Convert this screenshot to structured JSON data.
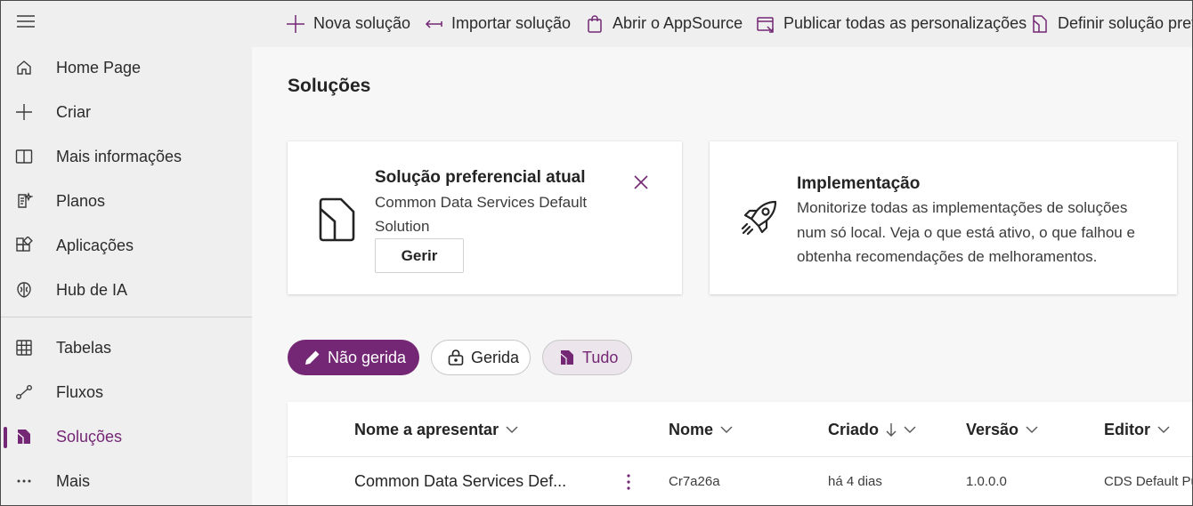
{
  "sidebar": {
    "items": [
      {
        "label": "Home Page",
        "icon": "home-icon"
      },
      {
        "label": "Criar",
        "icon": "plus-icon"
      },
      {
        "label": "Mais informações",
        "icon": "book-icon"
      },
      {
        "label": "Planos",
        "icon": "plan-icon"
      },
      {
        "label": "Aplicações",
        "icon": "apps-icon"
      },
      {
        "label": "Hub de IA",
        "icon": "ai-hub-icon"
      },
      {
        "label": "Tabelas",
        "icon": "table-icon"
      },
      {
        "label": "Fluxos",
        "icon": "flow-icon"
      },
      {
        "label": "Soluções",
        "icon": "solutions-icon",
        "active": true
      },
      {
        "label": "Mais",
        "icon": "more-icon"
      }
    ]
  },
  "toolbar": {
    "new_solution": "Nova solução",
    "import_solution": "Importar solução",
    "open_appsource": "Abrir o AppSource",
    "publish_all": "Publicar todas as personalizações",
    "set_preferred": "Definir solução preferencial"
  },
  "page": {
    "title": "Soluções"
  },
  "preferred_card": {
    "title": "Solução preferencial atual",
    "line1": "Common Data Services Default",
    "line2": "Solution",
    "manage_label": "Gerir"
  },
  "deployment_card": {
    "title": "Implementação",
    "line1": "Monitorize todas as implementações de soluções",
    "line2": "num só local. Veja o que está ativo, o que falhou e",
    "line3": "obtenha recomendações de melhoramentos."
  },
  "filters": {
    "unmanaged": "Não gerida",
    "managed": "Gerida",
    "all": "Tudo"
  },
  "grid": {
    "columns": {
      "display_name": "Nome a apresentar",
      "name": "Nome",
      "created": "Criado",
      "version": "Versão",
      "publisher": "Editor"
    },
    "rows": [
      {
        "display_name": "Common Data Services Def...",
        "name": "Cr7a26a",
        "created": "há 4 dias",
        "version": "1.0.0.0",
        "publisher": "CDS Default Publisher"
      }
    ]
  },
  "colors": {
    "accent": "#742774",
    "sidebar_bg": "#efefef",
    "main_bg": "#f7f7f7"
  }
}
